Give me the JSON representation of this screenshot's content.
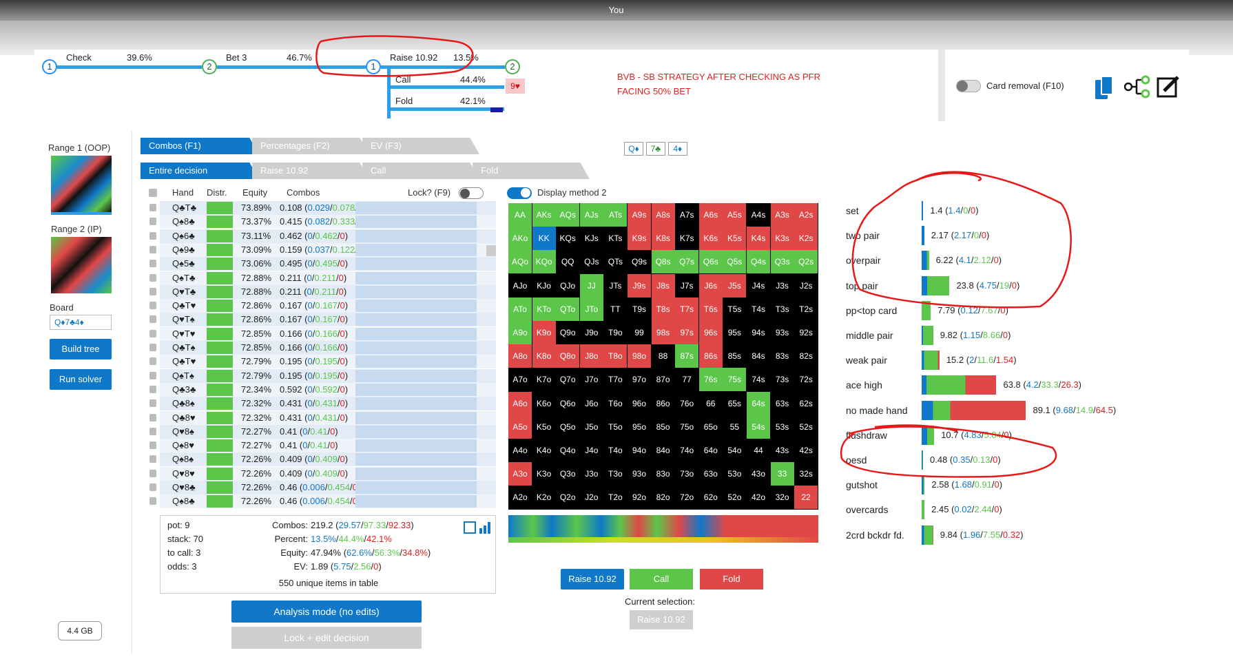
{
  "window": {
    "title": "You"
  },
  "tree": {
    "nodes": [
      "1",
      "2",
      "1",
      "2"
    ],
    "check_label": "Check",
    "check_pct": "39.6%",
    "bet_label": "Bet 3",
    "bet_pct": "46.7%",
    "raise_label": "Raise 10.92",
    "raise_pct": "13.5%",
    "call_label": "Call",
    "call_pct": "44.4%",
    "fold_label": "Fold",
    "fold_pct": "42.1%",
    "card_badge": "9♥"
  },
  "annotation": {
    "line1": "BVB - SB STRATEGY AFTER CHECKING AS PFR",
    "line2": "FACING 50% BET"
  },
  "right_panel": {
    "card_removal_label": "Card removal (F10)"
  },
  "sidebar": {
    "range1_label": "Range 1 (OOP)",
    "range2_label": "Range 2 (IP)",
    "board_label": "Board",
    "board_value": "Q♦7♣4♦",
    "build_tree": "Build tree",
    "run_solver": "Run solver",
    "memory": "4.4 GB"
  },
  "tabs": {
    "row1": [
      "Combos (F1)",
      "Percentages (F2)",
      "EV (F3)"
    ],
    "row2": [
      "Entire decision",
      "Raise 10.92",
      "Call",
      "Fold"
    ]
  },
  "board_cards": [
    "Q♦",
    "7♣",
    "4♦"
  ],
  "table": {
    "headers": [
      "Hand",
      "Distr.",
      "Equity",
      "Combos"
    ],
    "lock_label": "Lock? (F9)",
    "rows": [
      {
        "hand": "Q♣T♣",
        "eq": "73.89%",
        "c": "0.108",
        "b": "0.029",
        "g": "0.078",
        "r": "0"
      },
      {
        "hand": "Q♠8♣",
        "eq": "73.37%",
        "c": "0.415",
        "b": "0.082",
        "g": "0.333",
        "r": "0"
      },
      {
        "hand": "Q♠6♣",
        "eq": "73.11%",
        "c": "0.462",
        "b": "0",
        "g": "0.462",
        "r": "0"
      },
      {
        "hand": "Q♠9♣",
        "eq": "73.09%",
        "c": "0.159",
        "b": "0.037",
        "g": "0.122",
        "r": "0"
      },
      {
        "hand": "Q♠5♣",
        "eq": "73.06%",
        "c": "0.495",
        "b": "0",
        "g": "0.495",
        "r": "0"
      },
      {
        "hand": "Q♠T♣",
        "eq": "72.88%",
        "c": "0.211",
        "b": "0",
        "g": "0.211",
        "r": "0"
      },
      {
        "hand": "Q♥T♣",
        "eq": "72.88%",
        "c": "0.211",
        "b": "0",
        "g": "0.211",
        "r": "0"
      },
      {
        "hand": "Q♣T♥",
        "eq": "72.86%",
        "c": "0.167",
        "b": "0",
        "g": "0.167",
        "r": "0"
      },
      {
        "hand": "Q♥T♠",
        "eq": "72.86%",
        "c": "0.167",
        "b": "0",
        "g": "0.167",
        "r": "0"
      },
      {
        "hand": "Q♥T♥",
        "eq": "72.85%",
        "c": "0.166",
        "b": "0",
        "g": "0.166",
        "r": "0"
      },
      {
        "hand": "Q♣T♠",
        "eq": "72.85%",
        "c": "0.166",
        "b": "0",
        "g": "0.166",
        "r": "0"
      },
      {
        "hand": "Q♣T♥",
        "eq": "72.79%",
        "c": "0.195",
        "b": "0",
        "g": "0.195",
        "r": "0"
      },
      {
        "hand": "Q♠T♠",
        "eq": "72.79%",
        "c": "0.195",
        "b": "0",
        "g": "0.195",
        "r": "0"
      },
      {
        "hand": "Q♣3♣",
        "eq": "72.34%",
        "c": "0.592",
        "b": "0",
        "g": "0.592",
        "r": "0"
      },
      {
        "hand": "Q♣8♠",
        "eq": "72.32%",
        "c": "0.431",
        "b": "0",
        "g": "0.431",
        "r": "0"
      },
      {
        "hand": "Q♣8♥",
        "eq": "72.32%",
        "c": "0.431",
        "b": "0",
        "g": "0.431",
        "r": "0"
      },
      {
        "hand": "Q♥8♠",
        "eq": "72.27%",
        "c": "0.41",
        "b": "0",
        "g": "0.41",
        "r": "0"
      },
      {
        "hand": "Q♠8♥",
        "eq": "72.27%",
        "c": "0.41",
        "b": "0",
        "g": "0.41",
        "r": "0"
      },
      {
        "hand": "Q♠8♠",
        "eq": "72.26%",
        "c": "0.409",
        "b": "0",
        "g": "0.409",
        "r": "0"
      },
      {
        "hand": "Q♥8♥",
        "eq": "72.26%",
        "c": "0.409",
        "b": "0",
        "g": "0.409",
        "r": "0"
      },
      {
        "hand": "Q♥8♣",
        "eq": "72.26%",
        "c": "0.46",
        "b": "0.006",
        "g": "0.454",
        "r": "0"
      },
      {
        "hand": "Q♠8♣",
        "eq": "72.26%",
        "c": "0.46",
        "b": "0.006",
        "g": "0.454",
        "r": "0"
      }
    ]
  },
  "summary": {
    "pot": "pot: 9",
    "stack": "stack: 70",
    "to_call": "to call: 3",
    "odds": "odds: 3",
    "combos_label": "Combos:",
    "combos_total": "219.2",
    "combos_b": "29.57",
    "combos_g": "97.33",
    "combos_r": "92.33",
    "percent_label": "Percent:",
    "percent_b": "13.5%",
    "percent_g": "44.4%",
    "percent_r": "42.1%",
    "equity_label": "Equity:",
    "equity_total": "47.94%",
    "equity_b": "62.6%",
    "equity_g": "56.3%",
    "equity_r": "34.8%",
    "ev_label": "EV:",
    "ev_total": "1.89",
    "ev_b": "5.75",
    "ev_g": "2.56",
    "ev_r": "0",
    "unique": "550 unique items in table"
  },
  "buttons": {
    "analysis_mode": "Analysis mode (no edits)",
    "lock_edit": "Lock + edit decision",
    "raise": "Raise 10.92",
    "call": "Call",
    "fold": "Fold",
    "current_selection_label": "Current selection:",
    "current_selection": "Raise 10.92",
    "display_method": "Display method 2"
  },
  "grid": {
    "rows": [
      [
        "AA",
        "AKs",
        "AQs",
        "AJs",
        "ATs",
        "A9s",
        "A8s",
        "A7s",
        "A6s",
        "A5s",
        "A4s",
        "A3s",
        "A2s"
      ],
      [
        "AKo",
        "KK",
        "KQs",
        "KJs",
        "KTs",
        "K9s",
        "K8s",
        "K7s",
        "K6s",
        "K5s",
        "K4s",
        "K3s",
        "K2s"
      ],
      [
        "AQo",
        "KQo",
        "QQ",
        "QJs",
        "QTs",
        "Q9s",
        "Q8s",
        "Q7s",
        "Q6s",
        "Q5s",
        "Q4s",
        "Q3s",
        "Q2s"
      ],
      [
        "AJo",
        "KJo",
        "QJo",
        "JJ",
        "JTs",
        "J9s",
        "J8s",
        "J7s",
        "J6s",
        "J5s",
        "J4s",
        "J3s",
        "J2s"
      ],
      [
        "ATo",
        "KTo",
        "QTo",
        "JTo",
        "TT",
        "T9s",
        "T8s",
        "T7s",
        "T6s",
        "T5s",
        "T4s",
        "T3s",
        "T2s"
      ],
      [
        "A9o",
        "K9o",
        "Q9o",
        "J9o",
        "T9o",
        "99",
        "98s",
        "97s",
        "96s",
        "95s",
        "94s",
        "93s",
        "92s"
      ],
      [
        "A8o",
        "K8o",
        "Q8o",
        "J8o",
        "T8o",
        "98o",
        "88",
        "87s",
        "86s",
        "85s",
        "84s",
        "83s",
        "82s"
      ],
      [
        "A7o",
        "K7o",
        "Q7o",
        "J7o",
        "T7o",
        "97o",
        "87o",
        "77",
        "76s",
        "75s",
        "74s",
        "73s",
        "72s"
      ],
      [
        "A6o",
        "K6o",
        "Q6o",
        "J6o",
        "T6o",
        "96o",
        "86o",
        "76o",
        "66",
        "65s",
        "64s",
        "63s",
        "62s"
      ],
      [
        "A5o",
        "K5o",
        "Q5o",
        "J5o",
        "T5o",
        "95o",
        "85o",
        "75o",
        "65o",
        "55",
        "54s",
        "53s",
        "52s"
      ],
      [
        "A4o",
        "K4o",
        "Q4o",
        "J4o",
        "T4o",
        "94o",
        "84o",
        "74o",
        "64o",
        "54o",
        "44",
        "43s",
        "42s"
      ],
      [
        "A3o",
        "K3o",
        "Q3o",
        "J3o",
        "T3o",
        "93o",
        "83o",
        "73o",
        "63o",
        "53o",
        "43o",
        "33",
        "32s"
      ],
      [
        "A2o",
        "K2o",
        "Q2o",
        "J2o",
        "T2o",
        "92o",
        "82o",
        "72o",
        "62o",
        "52o",
        "42o",
        "32o",
        "22"
      ]
    ],
    "colors": [
      [
        "g",
        "g",
        "g",
        "g",
        "g",
        "r",
        "r",
        "k",
        "r",
        "r",
        "k",
        "r",
        "r"
      ],
      [
        "g",
        "b",
        "k",
        "k",
        "k",
        "r",
        "r",
        "k",
        "r",
        "r",
        "r",
        "r",
        "r"
      ],
      [
        "g",
        "g",
        "k",
        "k",
        "k",
        "k",
        "g",
        "g",
        "g",
        "g",
        "g",
        "g",
        "g"
      ],
      [
        "k",
        "k",
        "k",
        "g",
        "k",
        "r",
        "r",
        "k",
        "r",
        "r",
        "k",
        "k",
        "k"
      ],
      [
        "g",
        "g",
        "g",
        "g",
        "k",
        "k",
        "r",
        "r",
        "r",
        "k",
        "k",
        "k",
        "k"
      ],
      [
        "g",
        "r",
        "k",
        "k",
        "k",
        "k",
        "r",
        "r",
        "r",
        "k",
        "k",
        "k",
        "k"
      ],
      [
        "r",
        "r",
        "r",
        "r",
        "r",
        "r",
        "k",
        "g",
        "r",
        "k",
        "k",
        "k",
        "k"
      ],
      [
        "k",
        "k",
        "k",
        "k",
        "k",
        "k",
        "k",
        "k",
        "g",
        "g",
        "k",
        "k",
        "k"
      ],
      [
        "r",
        "k",
        "k",
        "k",
        "k",
        "k",
        "k",
        "k",
        "k",
        "k",
        "g",
        "k",
        "k"
      ],
      [
        "r",
        "k",
        "k",
        "k",
        "k",
        "k",
        "k",
        "k",
        "k",
        "k",
        "g",
        "k",
        "k"
      ],
      [
        "k",
        "k",
        "k",
        "k",
        "k",
        "k",
        "k",
        "k",
        "k",
        "k",
        "k",
        "k",
        "k"
      ],
      [
        "r",
        "k",
        "k",
        "k",
        "k",
        "k",
        "k",
        "k",
        "k",
        "k",
        "k",
        "g",
        "k"
      ],
      [
        "k",
        "k",
        "k",
        "k",
        "k",
        "k",
        "k",
        "k",
        "k",
        "k",
        "k",
        "k",
        "r"
      ]
    ]
  },
  "stats": [
    {
      "name": "set",
      "total": "1.4",
      "b": "1.4",
      "g": "0",
      "r": "0"
    },
    {
      "name": "two pair",
      "total": "2.17",
      "b": "2.17",
      "g": "0",
      "r": "0"
    },
    {
      "name": "overpair",
      "total": "6.22",
      "b": "4.1",
      "g": "2.12",
      "r": "0"
    },
    {
      "name": "top pair",
      "total": "23.8",
      "b": "4.75",
      "g": "19",
      "r": "0"
    },
    {
      "name": "pp<top card",
      "total": "7.79",
      "b": "0.12",
      "g": "7.67",
      "r": "0"
    },
    {
      "name": "middle pair",
      "total": "9.82",
      "b": "1.15",
      "g": "8.66",
      "r": "0"
    },
    {
      "name": "weak pair",
      "total": "15.2",
      "b": "2",
      "g": "11.6",
      "r": "1.54"
    },
    {
      "name": "ace high",
      "total": "63.8",
      "b": "4.2",
      "g": "33.3",
      "r": "26.3"
    },
    {
      "name": "no made hand",
      "total": "89.1",
      "b": "9.68",
      "g": "14.9",
      "r": "64.5"
    },
    {
      "name": "flushdraw",
      "total": "10.7",
      "b": "4.83",
      "g": "5.84",
      "r": "0"
    },
    {
      "name": "oesd",
      "total": "0.48",
      "b": "0.35",
      "g": "0.13",
      "r": "0"
    },
    {
      "name": "gutshot",
      "total": "2.58",
      "b": "1.68",
      "g": "0.91",
      "r": "0"
    },
    {
      "name": "overcards",
      "total": "2.45",
      "b": "0.02",
      "g": "2.44",
      "r": "0"
    },
    {
      "name": "2crd bckdr fd.",
      "total": "9.84",
      "b": "1.96",
      "g": "7.55",
      "r": "0.32"
    }
  ],
  "colors": {
    "raise": "#0f78c8",
    "call": "#5cc64a",
    "fold": "#e04848"
  }
}
